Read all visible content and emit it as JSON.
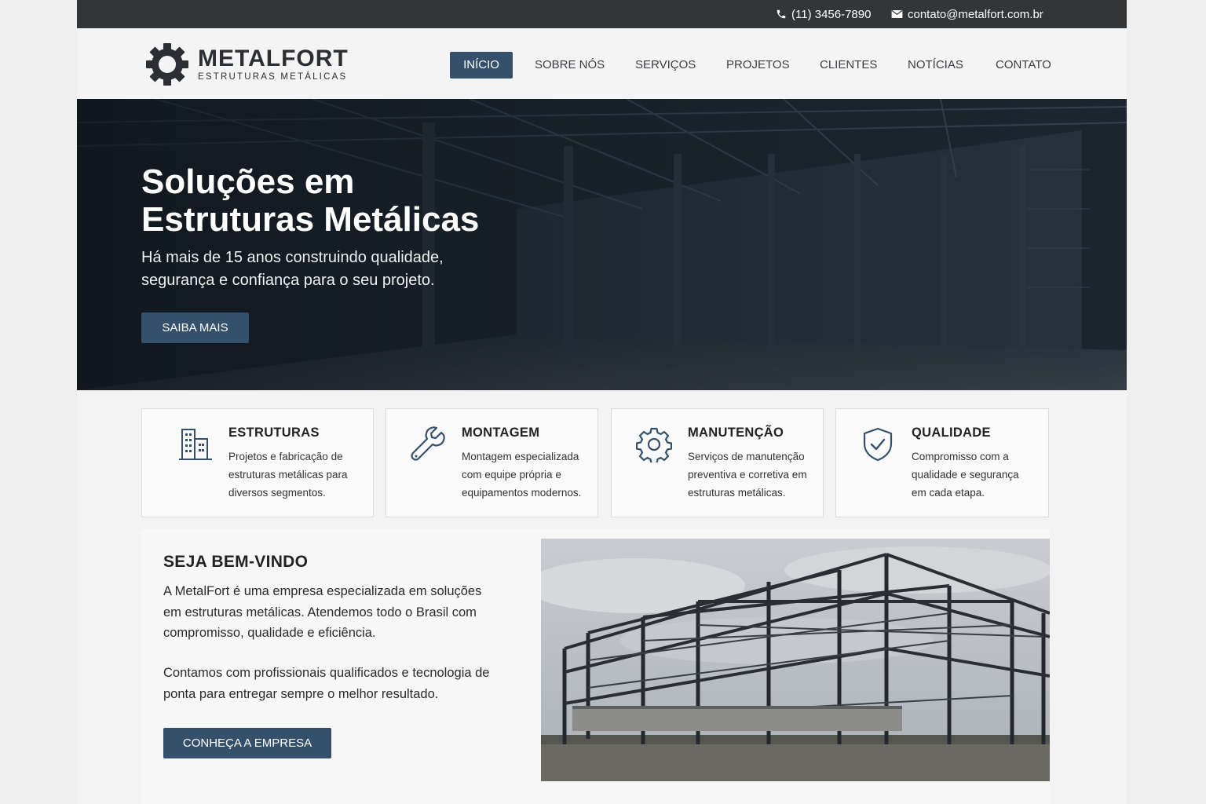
{
  "topbar": {
    "phone": "(11) 3456-7890",
    "email": "contato@metalfort.com.br",
    "icons": [
      "phone-icon",
      "envelope-icon"
    ]
  },
  "logo": {
    "name": "METALFORT",
    "tagline": "ESTRUTURAS METÁLICAS",
    "icon": "gear-icon"
  },
  "nav": {
    "items": [
      {
        "label": "INÍCIO",
        "active": true
      },
      {
        "label": "SOBRE NÓS",
        "active": false
      },
      {
        "label": "SERVIÇOS",
        "active": false
      },
      {
        "label": "PROJETOS",
        "active": false
      },
      {
        "label": "CLIENTES",
        "active": false
      },
      {
        "label": "NOTÍCIAS",
        "active": false
      },
      {
        "label": "CONTATO",
        "active": false
      }
    ]
  },
  "hero": {
    "title_line1": "Soluções em",
    "title_line2": "Estruturas Metálicas",
    "subtitle": "Há mais de 15 anos construindo qualidade, segurança e confiança para o seu projeto.",
    "button": "SAIBA MAIS"
  },
  "features": [
    {
      "title": "ESTRUTURAS",
      "text": "Projetos e fabricação de estruturas metálicas para diversos segmentos.",
      "icon": "building-icon"
    },
    {
      "title": "MONTAGEM",
      "text": "Montagem especializada com equipe própria e equipamentos modernos.",
      "icon": "wrench-icon"
    },
    {
      "title": "MANUTENÇÃO",
      "text": "Serviços de manutenção preventiva e corretiva em estruturas metálicas.",
      "icon": "gear-icon"
    },
    {
      "title": "QUALIDADE",
      "text": "Compromisso com a qualidade e segurança em cada etapa.",
      "icon": "shield-check-icon"
    }
  ],
  "welcome": {
    "title": "SEJA BEM-VINDO",
    "paragraph1": "A MetalFort é uma empresa especializada em soluções em estruturas metálicas. Atendemos todo o Brasil com compromisso, qualidade e eficiência.",
    "paragraph2": "Contamos com profissionais qualificados e tecnologia de ponta para entregar sempre o melhor resultado.",
    "button": "CONHEÇA A EMPRESA"
  },
  "colors": {
    "topbar": "#333639",
    "accent": "#34506b",
    "page_bg": "#f3f3f3"
  }
}
